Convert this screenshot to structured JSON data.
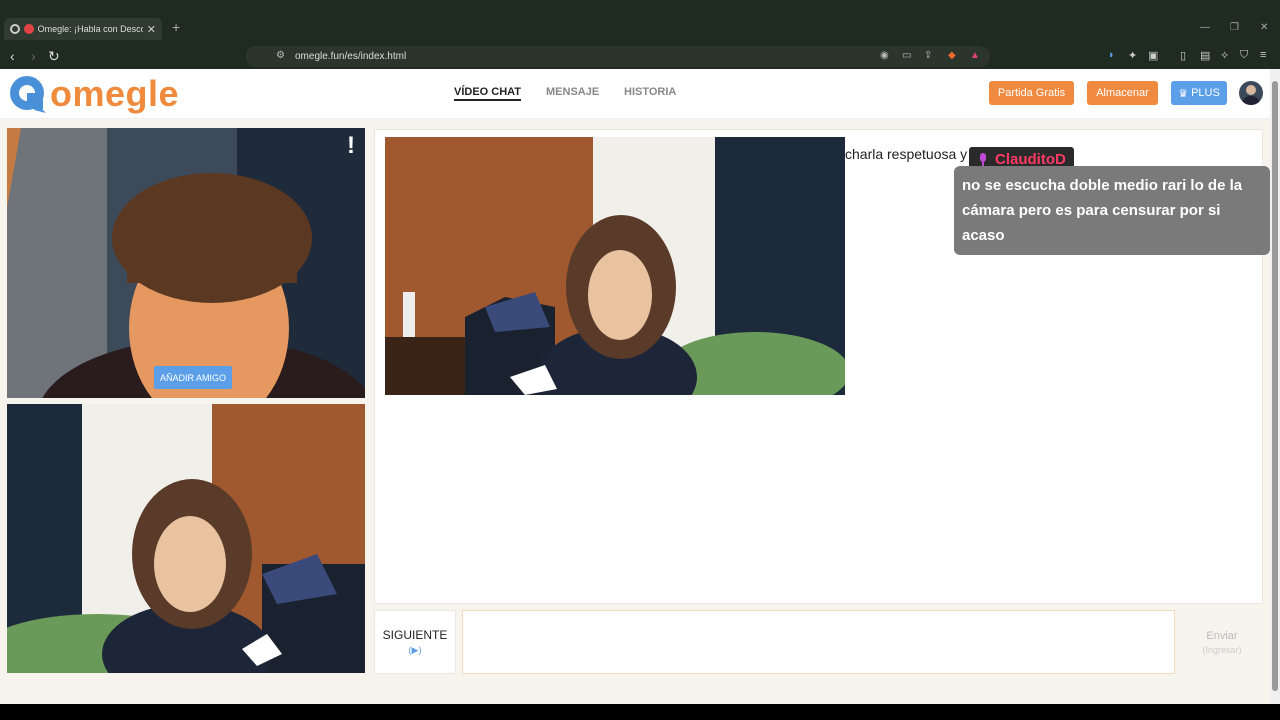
{
  "browser": {
    "tab_title": "Omegle: ¡Habla con Desconoc",
    "url": "omegle.fun/es/index.html"
  },
  "header": {
    "logo_text": "omegle",
    "nav": [
      "VÍDEO CHAT",
      "MENSAJE",
      "HISTORIA"
    ],
    "btn_free": "Partida Gratis",
    "btn_store": "Almacenar",
    "btn_plus": "PLUS"
  },
  "self_video": {
    "add_friend": "AÑADIR AMIGO",
    "report": "!"
  },
  "chat": {
    "partial_line": "charla respetuosa y ar"
  },
  "overlay": {
    "username": "ClauditoD",
    "message": "no se escucha doble medio rari lo de la cámara pero es para censurar por si acaso"
  },
  "controls": {
    "next_label": "SIGUIENTE",
    "next_hint": "(▶)",
    "send_label": "Enviar",
    "send_hint": "(Ingresar)"
  },
  "colors": {
    "accent_orange": "#ef8a40",
    "accent_blue": "#5b9fe8",
    "username_pink": "#ff3a64"
  }
}
